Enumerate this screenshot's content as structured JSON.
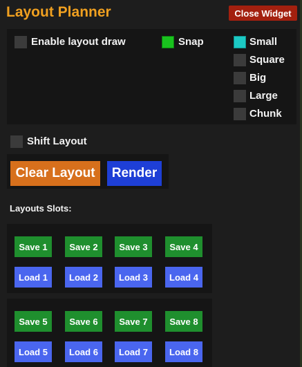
{
  "window": {
    "title": "Layout Planner",
    "close_label": "Close Widget"
  },
  "options": {
    "enable_layout_draw": "Enable layout draw",
    "snap": "Snap",
    "shift_layout": "Shift Layout"
  },
  "sizes": {
    "small": "Small",
    "square": "Square",
    "big": "Big",
    "large": "Large",
    "chunk": "Chunk"
  },
  "actions": {
    "clear_layout": "Clear Layout",
    "render": "Render"
  },
  "slots": {
    "heading": "Layouts Slots:",
    "save": [
      "Save 1",
      "Save 2",
      "Save 3",
      "Save 4",
      "Save 5",
      "Save 6",
      "Save 7",
      "Save 8"
    ],
    "load": [
      "Load 1",
      "Load 2",
      "Load 3",
      "Load 4",
      "Load 5",
      "Load 6",
      "Load 7",
      "Load 8"
    ]
  },
  "colors": {
    "title": "#f0a020",
    "close": "#a3200f",
    "clear_layout": "#d7701c",
    "render": "#1e3fd6",
    "save": "#1f8f2e",
    "load": "#4a66ef",
    "checked_snap": "#19c21e",
    "checked_small": "#1cc9c4"
  },
  "state": {
    "enable_layout_draw": false,
    "snap": true,
    "selected_size": "Small",
    "shift_layout": false
  }
}
